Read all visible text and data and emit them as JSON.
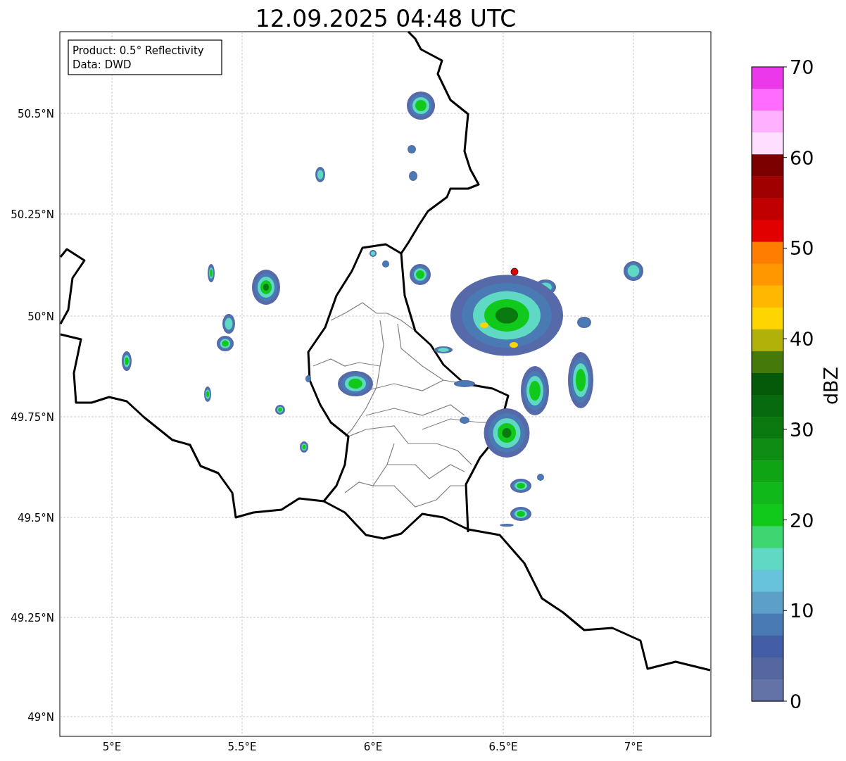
{
  "title": "12.09.2025 04:48 UTC",
  "legend": {
    "lines": [
      "Product: 0.5° Reflectivity",
      "Data: DWD"
    ]
  },
  "map": {
    "lat_ticks": [
      "50.5°N",
      "50.25°N",
      "50°N",
      "49.75°N",
      "49.5°N",
      "49.25°N",
      "49°N"
    ],
    "lon_ticks": [
      "5°E",
      "5.5°E",
      "6°E",
      "6.5°E",
      "7°E"
    ]
  },
  "colorbar": {
    "label": "dBZ",
    "ticks": [
      "70",
      "60",
      "50",
      "40",
      "30",
      "20",
      "10",
      "0"
    ],
    "segments": [
      {
        "color": "#ea38ea"
      },
      {
        "color": "#ff6cff"
      },
      {
        "color": "#ffb1ff"
      },
      {
        "color": "#ffdfff"
      },
      {
        "color": "#7c0000"
      },
      {
        "color": "#a00000"
      },
      {
        "color": "#c00000"
      },
      {
        "color": "#e00000"
      },
      {
        "color": "#ff7d00"
      },
      {
        "color": "#ff9800"
      },
      {
        "color": "#ffb700"
      },
      {
        "color": "#ffd500"
      },
      {
        "color": "#b0b20a"
      },
      {
        "color": "#457a0b"
      },
      {
        "color": "#055a0a"
      },
      {
        "color": "#076a0f"
      },
      {
        "color": "#0a7a10"
      },
      {
        "color": "#0e8c14"
      },
      {
        "color": "#0fa414"
      },
      {
        "color": "#10b81a"
      },
      {
        "color": "#11c91a"
      },
      {
        "color": "#3dd671"
      },
      {
        "color": "#5fd8c4"
      },
      {
        "color": "#67c3dc"
      },
      {
        "color": "#5c9fc7"
      },
      {
        "color": "#4a7ab3"
      },
      {
        "color": "#435ea4"
      },
      {
        "color": "#55679f"
      },
      {
        "color": "#6473a7"
      }
    ]
  }
}
